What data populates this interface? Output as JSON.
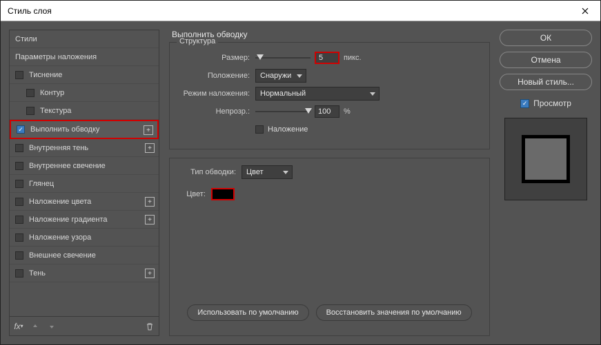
{
  "window": {
    "title": "Стиль слоя"
  },
  "sidebar": {
    "heading_styles": "Стили",
    "heading_blend": "Параметры наложения",
    "items": [
      {
        "label": "Тиснение",
        "checked": false,
        "indent": 0,
        "plus": false,
        "selected": false
      },
      {
        "label": "Контур",
        "checked": false,
        "indent": 1,
        "plus": false,
        "selected": false
      },
      {
        "label": "Текстура",
        "checked": false,
        "indent": 1,
        "plus": false,
        "selected": false
      },
      {
        "label": "Выполнить обводку",
        "checked": true,
        "indent": 0,
        "plus": true,
        "selected": true
      },
      {
        "label": "Внутренняя тень",
        "checked": false,
        "indent": 0,
        "plus": true,
        "selected": false
      },
      {
        "label": "Внутреннее свечение",
        "checked": false,
        "indent": 0,
        "plus": false,
        "selected": false
      },
      {
        "label": "Глянец",
        "checked": false,
        "indent": 0,
        "plus": false,
        "selected": false
      },
      {
        "label": "Наложение цвета",
        "checked": false,
        "indent": 0,
        "plus": true,
        "selected": false
      },
      {
        "label": "Наложение градиента",
        "checked": false,
        "indent": 0,
        "plus": true,
        "selected": false
      },
      {
        "label": "Наложение узора",
        "checked": false,
        "indent": 0,
        "plus": false,
        "selected": false
      },
      {
        "label": "Внешнее свечение",
        "checked": false,
        "indent": 0,
        "plus": false,
        "selected": false
      },
      {
        "label": "Тень",
        "checked": false,
        "indent": 0,
        "plus": true,
        "selected": false
      }
    ],
    "footer_fx": "fx"
  },
  "main": {
    "title": "Выполнить обводку",
    "group1": {
      "legend": "Структура",
      "size_label": "Размер:",
      "size_value": "5",
      "size_unit": "пикс.",
      "position_label": "Положение:",
      "position_value": "Снаружи",
      "blend_label": "Режим наложения:",
      "blend_value": "Нормальный",
      "opacity_label": "Непрозр.:",
      "opacity_value": "100",
      "opacity_unit": "%",
      "overprint_label": "Наложение"
    },
    "group2": {
      "filltype_label": "Тип обводки:",
      "filltype_value": "Цвет",
      "color_label": "Цвет:"
    },
    "buttons": {
      "make_default": "Использовать по умолчанию",
      "reset_default": "Восстановить значения по умолчанию"
    }
  },
  "right": {
    "ok": "ОК",
    "cancel": "Отмена",
    "newstyle": "Новый стиль...",
    "preview": "Просмотр"
  }
}
